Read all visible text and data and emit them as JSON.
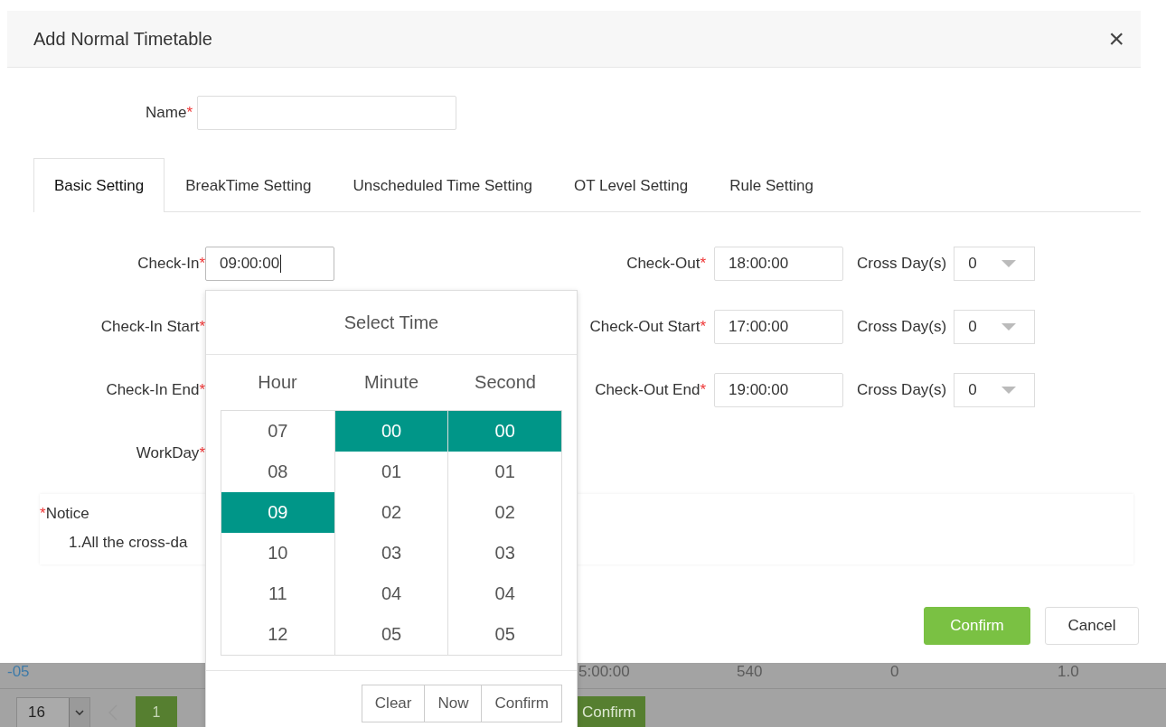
{
  "dialog": {
    "title": "Add Normal Timetable",
    "close": "×",
    "name_field": {
      "label": "Name",
      "required_mark": "*"
    },
    "tabs": [
      {
        "label": "Basic Setting",
        "selected": true
      },
      {
        "label": "BreakTime Setting",
        "selected": false
      },
      {
        "label": "Unscheduled Time Setting",
        "selected": false
      },
      {
        "label": "OT Level Setting",
        "selected": false
      },
      {
        "label": "Rule Setting",
        "selected": false
      }
    ],
    "left_fields": [
      {
        "label": "Check-In",
        "required_mark": "*",
        "value": "09:00:00",
        "focused": true
      },
      {
        "label": "Check-In Start",
        "required_mark": "*"
      },
      {
        "label": "Check-In End",
        "required_mark": "*"
      },
      {
        "label": "WorkDay",
        "required_mark": "*"
      }
    ],
    "right_fields": [
      {
        "label": "Check-Out",
        "required_mark": "*",
        "value": "18:00:00",
        "cross_label": "Cross Day(s)",
        "cross_value": "0"
      },
      {
        "label": "Check-Out Start",
        "required_mark": "*",
        "value": "17:00:00",
        "cross_label": "Cross Day(s)",
        "cross_value": "0"
      },
      {
        "label": "Check-Out End",
        "required_mark": "*",
        "value": "19:00:00",
        "cross_label": "Cross Day(s)",
        "cross_value": "0"
      }
    ],
    "notice": {
      "mark": "*",
      "title": "Notice",
      "lines": [
        "1.All the cross-da"
      ]
    },
    "buttons": [
      {
        "label": "Confirm",
        "kind": "primary"
      },
      {
        "label": "Cancel",
        "kind": "default"
      }
    ]
  },
  "time_picker": {
    "title": "Select Time",
    "columns": [
      {
        "header": "Hour",
        "items": [
          {
            "label": "07",
            "selected": false
          },
          {
            "label": "08",
            "selected": false
          },
          {
            "label": "09",
            "selected": true
          },
          {
            "label": "10",
            "selected": false
          },
          {
            "label": "11",
            "selected": false
          },
          {
            "label": "12",
            "selected": false
          }
        ]
      },
      {
        "header": "Minute",
        "items": [
          {
            "label": "00",
            "selected": true
          },
          {
            "label": "01",
            "selected": false
          },
          {
            "label": "02",
            "selected": false
          },
          {
            "label": "03",
            "selected": false
          },
          {
            "label": "04",
            "selected": false
          },
          {
            "label": "05",
            "selected": false
          }
        ]
      },
      {
        "header": "Second",
        "items": [
          {
            "label": "00",
            "selected": true
          },
          {
            "label": "01",
            "selected": false
          },
          {
            "label": "02",
            "selected": false
          },
          {
            "label": "03",
            "selected": false
          },
          {
            "label": "04",
            "selected": false
          },
          {
            "label": "05",
            "selected": false
          }
        ]
      }
    ],
    "buttons": [
      "Clear",
      "Now",
      "Confirm"
    ]
  },
  "background": {
    "row": [
      "-05",
      "5:00:00",
      "540",
      "0",
      "1.0"
    ],
    "page_size": "16",
    "page": "1",
    "confirm": "Confirm"
  }
}
